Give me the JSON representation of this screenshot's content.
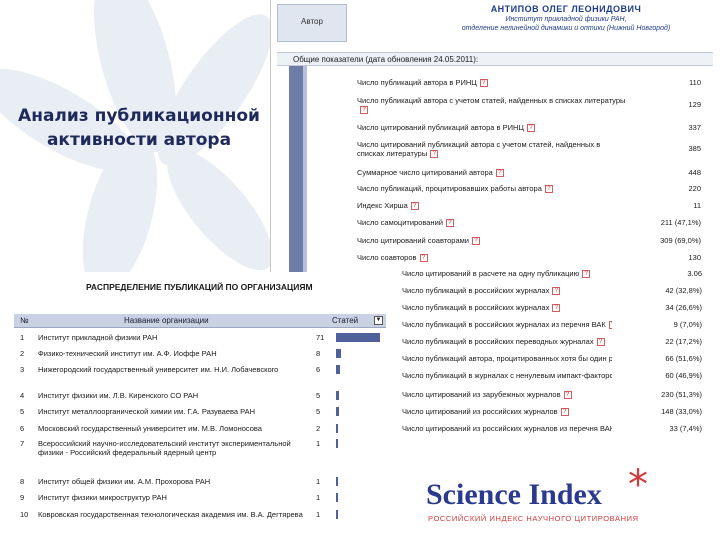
{
  "slide": {
    "title_line1": "Анализ публикационной",
    "title_line2": "активности автора"
  },
  "profile": {
    "author_label": "Автор",
    "author_name": "АНТИПОВ ОЛЕГ ЛЕОНИДОВИЧ",
    "affiliation_line1": "Институт прикладной физики РАН,",
    "affiliation_line2": "отделение нелинейной динамики и оптики (Нижний Новгород)",
    "section_title": "Общие показатели (дата обновления 24.05.2011):",
    "stats": [
      {
        "label": "Число публикаций автора в РИНЦ",
        "value": "110"
      },
      {
        "label": "Число публикаций автора с учетом статей, найденных в списках литературы",
        "value": "129"
      },
      {
        "label": "Число цитирований публикаций автора в РИНЦ",
        "value": "337"
      },
      {
        "label": "Число цитирований публикаций автора с учетом статей, найденных в списках литературы",
        "value": "385"
      },
      {
        "label": "Суммарное число цитирований автора",
        "value": "448"
      },
      {
        "label": "Число публикаций, процитировавших работы автора",
        "value": "220"
      },
      {
        "label": "Индекс Хирша",
        "value": "11"
      },
      {
        "label": "Число самоцитирований",
        "value": "211 (47,1%)"
      },
      {
        "label": "Число цитирований соавторами",
        "value": "309 (69,0%)"
      },
      {
        "label": "Число соавторов",
        "value": "130"
      }
    ]
  },
  "stats_continued": [
    {
      "label": "Число цитирований в расчете на одну публикацию",
      "value": "3.06"
    },
    {
      "label": "Число публикаций в российских журналах",
      "value": "42 (32,8%)"
    },
    {
      "label": "Число публикаций в российских журналах",
      "value": "34 (26,6%)"
    },
    {
      "label": "Число публикаций в российских журналах из перечня ВАК",
      "value": "9 (7,0%)"
    },
    {
      "label": "Число публикаций в российских переводных журналах",
      "value": "22 (17,2%)"
    },
    {
      "label": "Число публикаций автора, процитированных хотя бы один раз",
      "value": "66 (51,6%)"
    },
    {
      "label": "Число публикаций в журналах с ненулевым импакт-фактором",
      "value": "60 (46,9%)"
    },
    {
      "label": "Число цитирований из зарубежных журналов",
      "value": "230 (51,3%)"
    },
    {
      "label": "Число цитирований из российских журналов",
      "value": "148 (33,0%)"
    },
    {
      "label": "Число цитирований из российских журналов из перечня ВАК",
      "value": "33 (7,4%)"
    }
  ],
  "orgs": {
    "heading": "РАСПРЕДЕЛЕНИЕ ПУБЛИКАЦИЙ ПО ОРГАНИЗАЦИЯМ",
    "col_num": "№",
    "col_name": "Название организации",
    "col_count": "Статей",
    "rows": [
      {
        "n": "1",
        "name": "Институт прикладной физики РАН",
        "count": "71",
        "value": 71
      },
      {
        "n": "2",
        "name": "Физико-технический институт им. А.Ф. Иоффе РАН",
        "count": "8",
        "value": 8
      },
      {
        "n": "3",
        "name": "Нижегородский государственный университет им. Н.И. Лобачевского",
        "count": "6",
        "value": 6
      },
      {
        "n": "4",
        "name": "Институт физики им. Л.В. Киренского СО РАН",
        "count": "5",
        "value": 5
      },
      {
        "n": "5",
        "name": "Институт металлоорганической химии им. Г.А. Разуваева РАН",
        "count": "5",
        "value": 5
      },
      {
        "n": "6",
        "name": "Московский государственный университет им. М.В. Ломоносова",
        "count": "2",
        "value": 2
      },
      {
        "n": "7",
        "name": "Всероссийский научно-исследовательский институт экспериментальной физики - Российский федеральный ядерный центр",
        "count": "1",
        "value": 1
      },
      {
        "n": "8",
        "name": "Институт общей физики им. А.М. Прохорова РАН",
        "count": "1",
        "value": 1
      },
      {
        "n": "9",
        "name": "Институт физики микроструктур РАН",
        "count": "1",
        "value": 1
      },
      {
        "n": "10",
        "name": "Ковровская государственная технологическая академия им. В.А. Дегтярева",
        "count": "1",
        "value": 1
      }
    ]
  },
  "logo": {
    "word": "Science Index",
    "star": "*",
    "subtitle": "РОССИЙСКИЙ ИНДЕКС НАУЧНОГО ЦИТИРОВАНИЯ"
  },
  "icons": {
    "help": "?",
    "sort": "▼"
  },
  "colors": {
    "brand_blue": "#2b3a8e",
    "brand_red": "#d03a3a",
    "bar": "#50609a"
  }
}
